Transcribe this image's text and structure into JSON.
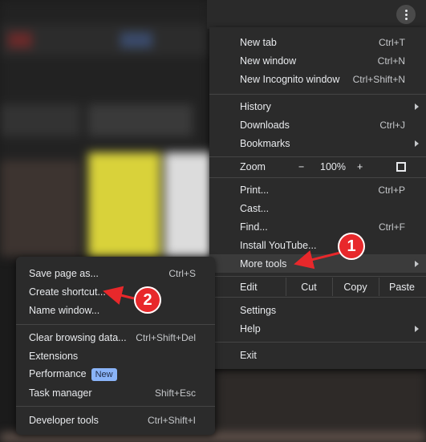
{
  "colors": {
    "menu_bg": "#2b2b2b",
    "accent_red": "#e8282b",
    "badge_blue": "#8ab4f8"
  },
  "main_menu": {
    "group1": [
      {
        "label": "New tab",
        "shortcut": "Ctrl+T"
      },
      {
        "label": "New window",
        "shortcut": "Ctrl+N"
      },
      {
        "label": "New Incognito window",
        "shortcut": "Ctrl+Shift+N"
      }
    ],
    "group2": [
      {
        "label": "History",
        "shortcut": "",
        "submenu": true
      },
      {
        "label": "Downloads",
        "shortcut": "Ctrl+J",
        "submenu": false
      },
      {
        "label": "Bookmarks",
        "shortcut": "",
        "submenu": true
      }
    ],
    "zoom": {
      "label": "Zoom",
      "minus": "−",
      "value": "100%",
      "plus": "+"
    },
    "group3": [
      {
        "label": "Print...",
        "shortcut": "Ctrl+P"
      },
      {
        "label": "Cast...",
        "shortcut": ""
      },
      {
        "label": "Find...",
        "shortcut": "Ctrl+F"
      },
      {
        "label": "Install YouTube...",
        "shortcut": ""
      },
      {
        "label": "More tools",
        "shortcut": "",
        "submenu": true
      }
    ],
    "edit": {
      "label": "Edit",
      "cut": "Cut",
      "copy": "Copy",
      "paste": "Paste"
    },
    "group4": [
      {
        "label": "Settings",
        "submenu": false
      },
      {
        "label": "Help",
        "submenu": true
      }
    ],
    "exit": {
      "label": "Exit"
    }
  },
  "sub_menu": {
    "group1": [
      {
        "label": "Save page as...",
        "shortcut": "Ctrl+S"
      },
      {
        "label": "Create shortcut...",
        "shortcut": ""
      },
      {
        "label": "Name window...",
        "shortcut": ""
      }
    ],
    "group2": [
      {
        "label": "Clear browsing data...",
        "shortcut": "Ctrl+Shift+Del"
      },
      {
        "label": "Extensions",
        "shortcut": ""
      },
      {
        "label": "Performance",
        "shortcut": "",
        "badge": "New"
      },
      {
        "label": "Task manager",
        "shortcut": "Shift+Esc"
      }
    ],
    "group3": [
      {
        "label": "Developer tools",
        "shortcut": "Ctrl+Shift+I"
      }
    ]
  },
  "callouts": {
    "one": "1",
    "two": "2"
  },
  "icons": {
    "kebab": "more-vert-icon",
    "fullscreen": "fullscreen-icon",
    "submenu_arrow": "chevron-right-icon"
  }
}
